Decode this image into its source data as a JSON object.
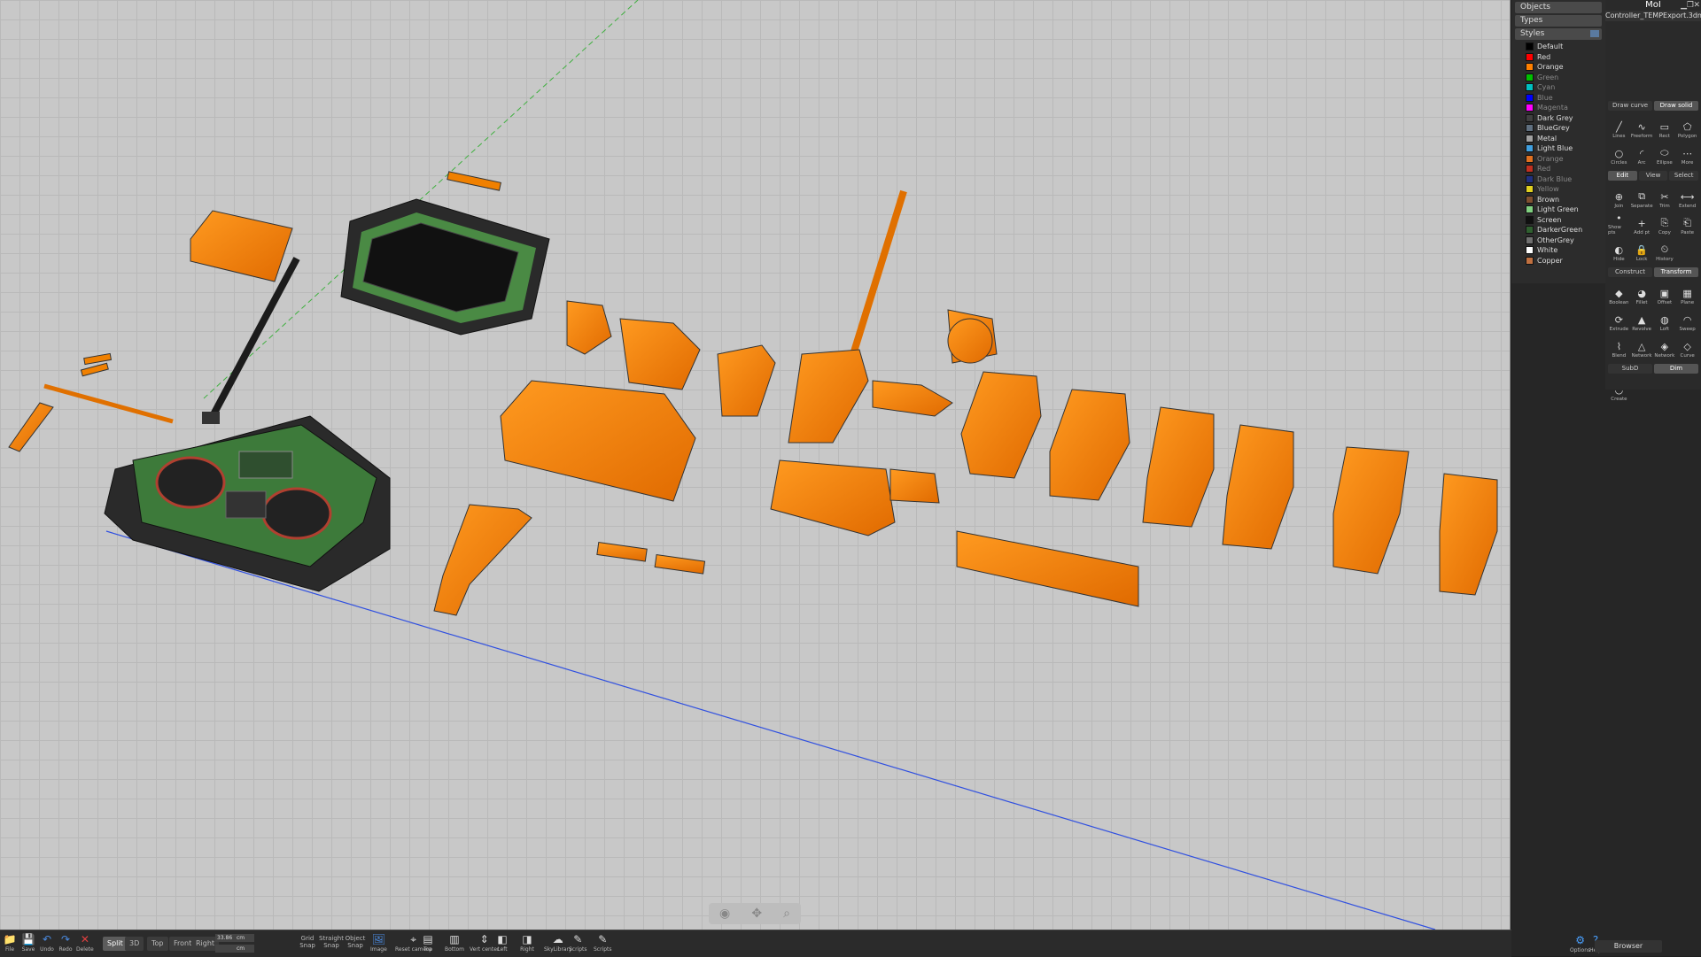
{
  "browser": {
    "sections": [
      "Objects",
      "Types",
      "Styles"
    ],
    "styles": [
      {
        "name": "Default",
        "color": "#000000",
        "dim": false
      },
      {
        "name": "Red",
        "color": "#ff0000",
        "dim": false
      },
      {
        "name": "Orange",
        "color": "#ff8000",
        "dim": false
      },
      {
        "name": "Green",
        "color": "#00c000",
        "dim": true
      },
      {
        "name": "Cyan",
        "color": "#00c0c0",
        "dim": true
      },
      {
        "name": "Blue",
        "color": "#0000ff",
        "dim": true
      },
      {
        "name": "Magenta",
        "color": "#ff00ff",
        "dim": true
      },
      {
        "name": "Dark Grey",
        "color": "#404040",
        "dim": false
      },
      {
        "name": "BlueGrey",
        "color": "#607080",
        "dim": false
      },
      {
        "name": "Metal",
        "color": "#a0a0a0",
        "dim": false
      },
      {
        "name": "Light Blue",
        "color": "#40a0e0",
        "dim": false
      },
      {
        "name": "Orange",
        "color": "#e07020",
        "dim": true
      },
      {
        "name": "Red",
        "color": "#c03020",
        "dim": true
      },
      {
        "name": "Dark Blue",
        "color": "#203080",
        "dim": true
      },
      {
        "name": "Yellow",
        "color": "#e0d020",
        "dim": true
      },
      {
        "name": "Brown",
        "color": "#805030",
        "dim": false
      },
      {
        "name": "Light Green",
        "color": "#80d080",
        "dim": false
      },
      {
        "name": "Screen",
        "color": "#101010",
        "dim": false
      },
      {
        "name": "DarkerGreen",
        "color": "#306030",
        "dim": false
      },
      {
        "name": "OtherGrey",
        "color": "#707070",
        "dim": false
      },
      {
        "name": "White",
        "color": "#ffffff",
        "dim": false
      },
      {
        "name": "Copper",
        "color": "#c07040",
        "dim": false
      }
    ]
  },
  "app": {
    "title": "MoI",
    "file": "Controller_TEMPExport.3dm"
  },
  "palette": {
    "draw_tabs": [
      "Draw curve",
      "Draw solid"
    ],
    "draw_tools": [
      "Lines",
      "Freeform",
      "Rect",
      "Polygon",
      "Circles",
      "Arc",
      "Ellipse",
      "More"
    ],
    "edit_tabs": [
      "Edit",
      "View",
      "Select"
    ],
    "edit_tools": [
      "Join",
      "Separate",
      "Trim",
      "Extend",
      "Show pts",
      "Add pt",
      "Copy",
      "Paste",
      "Hide",
      "Lock",
      "History"
    ],
    "construct_tabs": [
      "Construct",
      "Transform"
    ],
    "construct_tools": [
      "Boolean",
      "Fillet",
      "Offset",
      "Plane",
      "Extrude",
      "Revolve",
      "Loft",
      "Sweep",
      "Blend",
      "Network",
      "Network",
      "Curve"
    ],
    "subd_tabs": [
      "SubD",
      "Dim"
    ],
    "subd_tools": [
      "Create"
    ]
  },
  "bottom": {
    "file_tools": [
      "File",
      "Save",
      "Undo",
      "Redo",
      "Delete"
    ],
    "view_buttons": [
      "Split",
      "3D",
      "Top",
      "Front",
      "Right"
    ],
    "grid": {
      "value1": "33.86",
      "unit1": "cm",
      "value2": "",
      "unit2": "cm"
    },
    "snaps": [
      "Grid Snap",
      "Straight Snap",
      "Object Snap"
    ],
    "view_tools": [
      "Image",
      "Reset camera",
      "Top",
      "Bottom",
      "Vert center",
      "Left",
      "Right",
      "SkyLibrary",
      "Scripts",
      "Scripts"
    ],
    "options": "Options",
    "help": "Help",
    "browser": "Browser"
  },
  "colors": {
    "orange": "#ff8000",
    "viewport_bg": "#c8c8c8",
    "panel_bg": "#262626"
  }
}
